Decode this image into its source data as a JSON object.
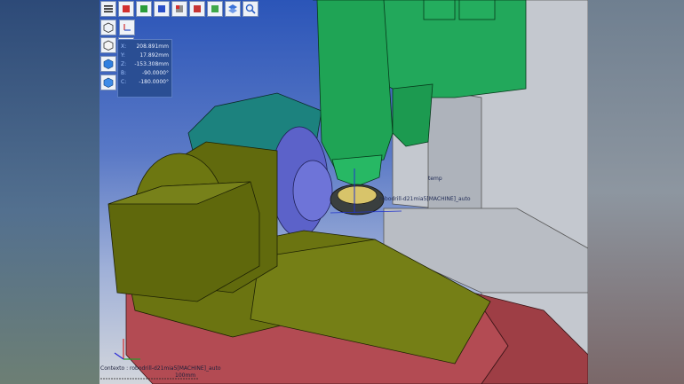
{
  "toolbar": {
    "buttons": [
      {
        "name": "menu-icon"
      },
      {
        "name": "view-red-cube-icon"
      },
      {
        "name": "view-green-cube-icon"
      },
      {
        "name": "view-blue-cube-icon"
      },
      {
        "name": "view-cube-red-icon"
      },
      {
        "name": "view-cube-red-2-icon"
      },
      {
        "name": "view-cube-green-icon"
      },
      {
        "name": "view-layers-icon"
      },
      {
        "name": "zoom-icon"
      }
    ]
  },
  "side_tools": {
    "row1": [
      "wireframe-cube-icon",
      "axes-xz-icon"
    ],
    "row2": [
      "outline-cube-icon",
      "blue-part-icon"
    ],
    "col": [
      "shaded-cube-icon",
      "solid-cube-icon"
    ]
  },
  "readout": {
    "x_label": "X:",
    "x_value": "208.891mm",
    "y_label": "Y:",
    "y_value": "17.892mm",
    "z_label": "Z:",
    "z_value": "-153.308mm",
    "b_label": "B:",
    "b_value": "-90.0000°",
    "c_label": "C:",
    "c_value": "-180.0000°"
  },
  "labels": {
    "temp": "temp",
    "tool": "robodrill-d21mia5[MACHINE]_auto",
    "context": "Contexto : robodrill-d21mia5[MACHINE]_auto",
    "scale": "100mm"
  },
  "colors": {
    "spindle": "#1fa85a",
    "fixture": "#5f6b0c",
    "table": "#b84a52",
    "rotary": "#5c60c8",
    "head": "#1f8a85",
    "frame": "#c8ccd2"
  }
}
